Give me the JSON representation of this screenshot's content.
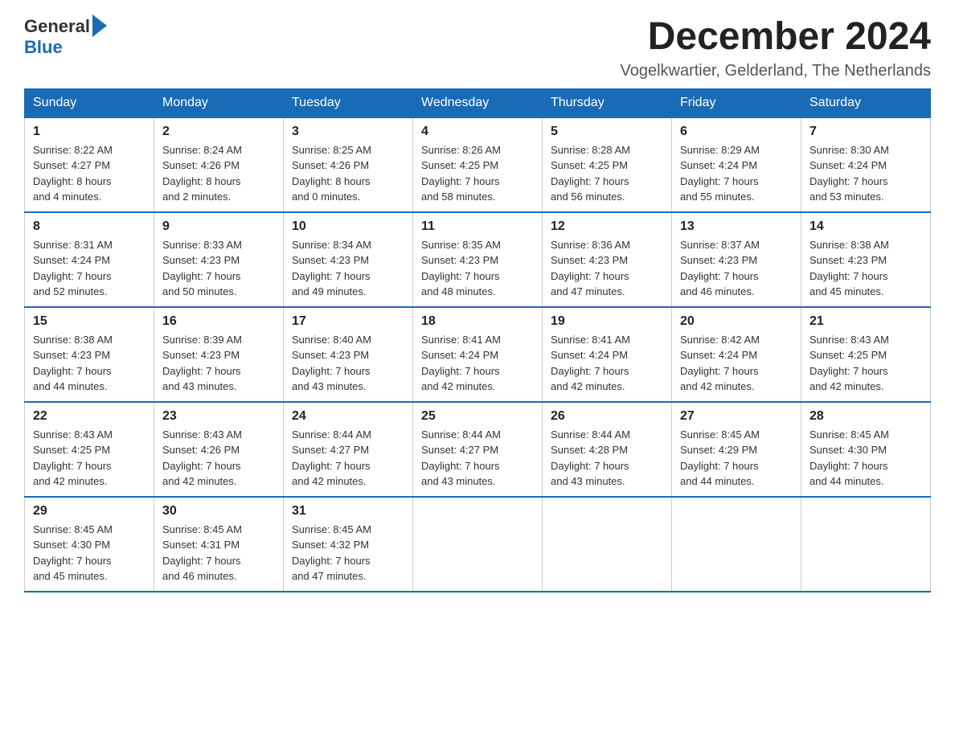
{
  "header": {
    "logo_general": "General",
    "logo_blue": "Blue",
    "title": "December 2024",
    "location": "Vogelkwartier, Gelderland, The Netherlands"
  },
  "days_of_week": [
    "Sunday",
    "Monday",
    "Tuesday",
    "Wednesday",
    "Thursday",
    "Friday",
    "Saturday"
  ],
  "weeks": [
    [
      {
        "day": "1",
        "sunrise": "8:22 AM",
        "sunset": "4:27 PM",
        "daylight": "8 hours and 4 minutes."
      },
      {
        "day": "2",
        "sunrise": "8:24 AM",
        "sunset": "4:26 PM",
        "daylight": "8 hours and 2 minutes."
      },
      {
        "day": "3",
        "sunrise": "8:25 AM",
        "sunset": "4:26 PM",
        "daylight": "8 hours and 0 minutes."
      },
      {
        "day": "4",
        "sunrise": "8:26 AM",
        "sunset": "4:25 PM",
        "daylight": "7 hours and 58 minutes."
      },
      {
        "day": "5",
        "sunrise": "8:28 AM",
        "sunset": "4:25 PM",
        "daylight": "7 hours and 56 minutes."
      },
      {
        "day": "6",
        "sunrise": "8:29 AM",
        "sunset": "4:24 PM",
        "daylight": "7 hours and 55 minutes."
      },
      {
        "day": "7",
        "sunrise": "8:30 AM",
        "sunset": "4:24 PM",
        "daylight": "7 hours and 53 minutes."
      }
    ],
    [
      {
        "day": "8",
        "sunrise": "8:31 AM",
        "sunset": "4:24 PM",
        "daylight": "7 hours and 52 minutes."
      },
      {
        "day": "9",
        "sunrise": "8:33 AM",
        "sunset": "4:23 PM",
        "daylight": "7 hours and 50 minutes."
      },
      {
        "day": "10",
        "sunrise": "8:34 AM",
        "sunset": "4:23 PM",
        "daylight": "7 hours and 49 minutes."
      },
      {
        "day": "11",
        "sunrise": "8:35 AM",
        "sunset": "4:23 PM",
        "daylight": "7 hours and 48 minutes."
      },
      {
        "day": "12",
        "sunrise": "8:36 AM",
        "sunset": "4:23 PM",
        "daylight": "7 hours and 47 minutes."
      },
      {
        "day": "13",
        "sunrise": "8:37 AM",
        "sunset": "4:23 PM",
        "daylight": "7 hours and 46 minutes."
      },
      {
        "day": "14",
        "sunrise": "8:38 AM",
        "sunset": "4:23 PM",
        "daylight": "7 hours and 45 minutes."
      }
    ],
    [
      {
        "day": "15",
        "sunrise": "8:38 AM",
        "sunset": "4:23 PM",
        "daylight": "7 hours and 44 minutes."
      },
      {
        "day": "16",
        "sunrise": "8:39 AM",
        "sunset": "4:23 PM",
        "daylight": "7 hours and 43 minutes."
      },
      {
        "day": "17",
        "sunrise": "8:40 AM",
        "sunset": "4:23 PM",
        "daylight": "7 hours and 43 minutes."
      },
      {
        "day": "18",
        "sunrise": "8:41 AM",
        "sunset": "4:24 PM",
        "daylight": "7 hours and 42 minutes."
      },
      {
        "day": "19",
        "sunrise": "8:41 AM",
        "sunset": "4:24 PM",
        "daylight": "7 hours and 42 minutes."
      },
      {
        "day": "20",
        "sunrise": "8:42 AM",
        "sunset": "4:24 PM",
        "daylight": "7 hours and 42 minutes."
      },
      {
        "day": "21",
        "sunrise": "8:43 AM",
        "sunset": "4:25 PM",
        "daylight": "7 hours and 42 minutes."
      }
    ],
    [
      {
        "day": "22",
        "sunrise": "8:43 AM",
        "sunset": "4:25 PM",
        "daylight": "7 hours and 42 minutes."
      },
      {
        "day": "23",
        "sunrise": "8:43 AM",
        "sunset": "4:26 PM",
        "daylight": "7 hours and 42 minutes."
      },
      {
        "day": "24",
        "sunrise": "8:44 AM",
        "sunset": "4:27 PM",
        "daylight": "7 hours and 42 minutes."
      },
      {
        "day": "25",
        "sunrise": "8:44 AM",
        "sunset": "4:27 PM",
        "daylight": "7 hours and 43 minutes."
      },
      {
        "day": "26",
        "sunrise": "8:44 AM",
        "sunset": "4:28 PM",
        "daylight": "7 hours and 43 minutes."
      },
      {
        "day": "27",
        "sunrise": "8:45 AM",
        "sunset": "4:29 PM",
        "daylight": "7 hours and 44 minutes."
      },
      {
        "day": "28",
        "sunrise": "8:45 AM",
        "sunset": "4:30 PM",
        "daylight": "7 hours and 44 minutes."
      }
    ],
    [
      {
        "day": "29",
        "sunrise": "8:45 AM",
        "sunset": "4:30 PM",
        "daylight": "7 hours and 45 minutes."
      },
      {
        "day": "30",
        "sunrise": "8:45 AM",
        "sunset": "4:31 PM",
        "daylight": "7 hours and 46 minutes."
      },
      {
        "day": "31",
        "sunrise": "8:45 AM",
        "sunset": "4:32 PM",
        "daylight": "7 hours and 47 minutes."
      },
      null,
      null,
      null,
      null
    ]
  ],
  "labels": {
    "sunrise": "Sunrise:",
    "sunset": "Sunset:",
    "daylight": "Daylight:"
  }
}
